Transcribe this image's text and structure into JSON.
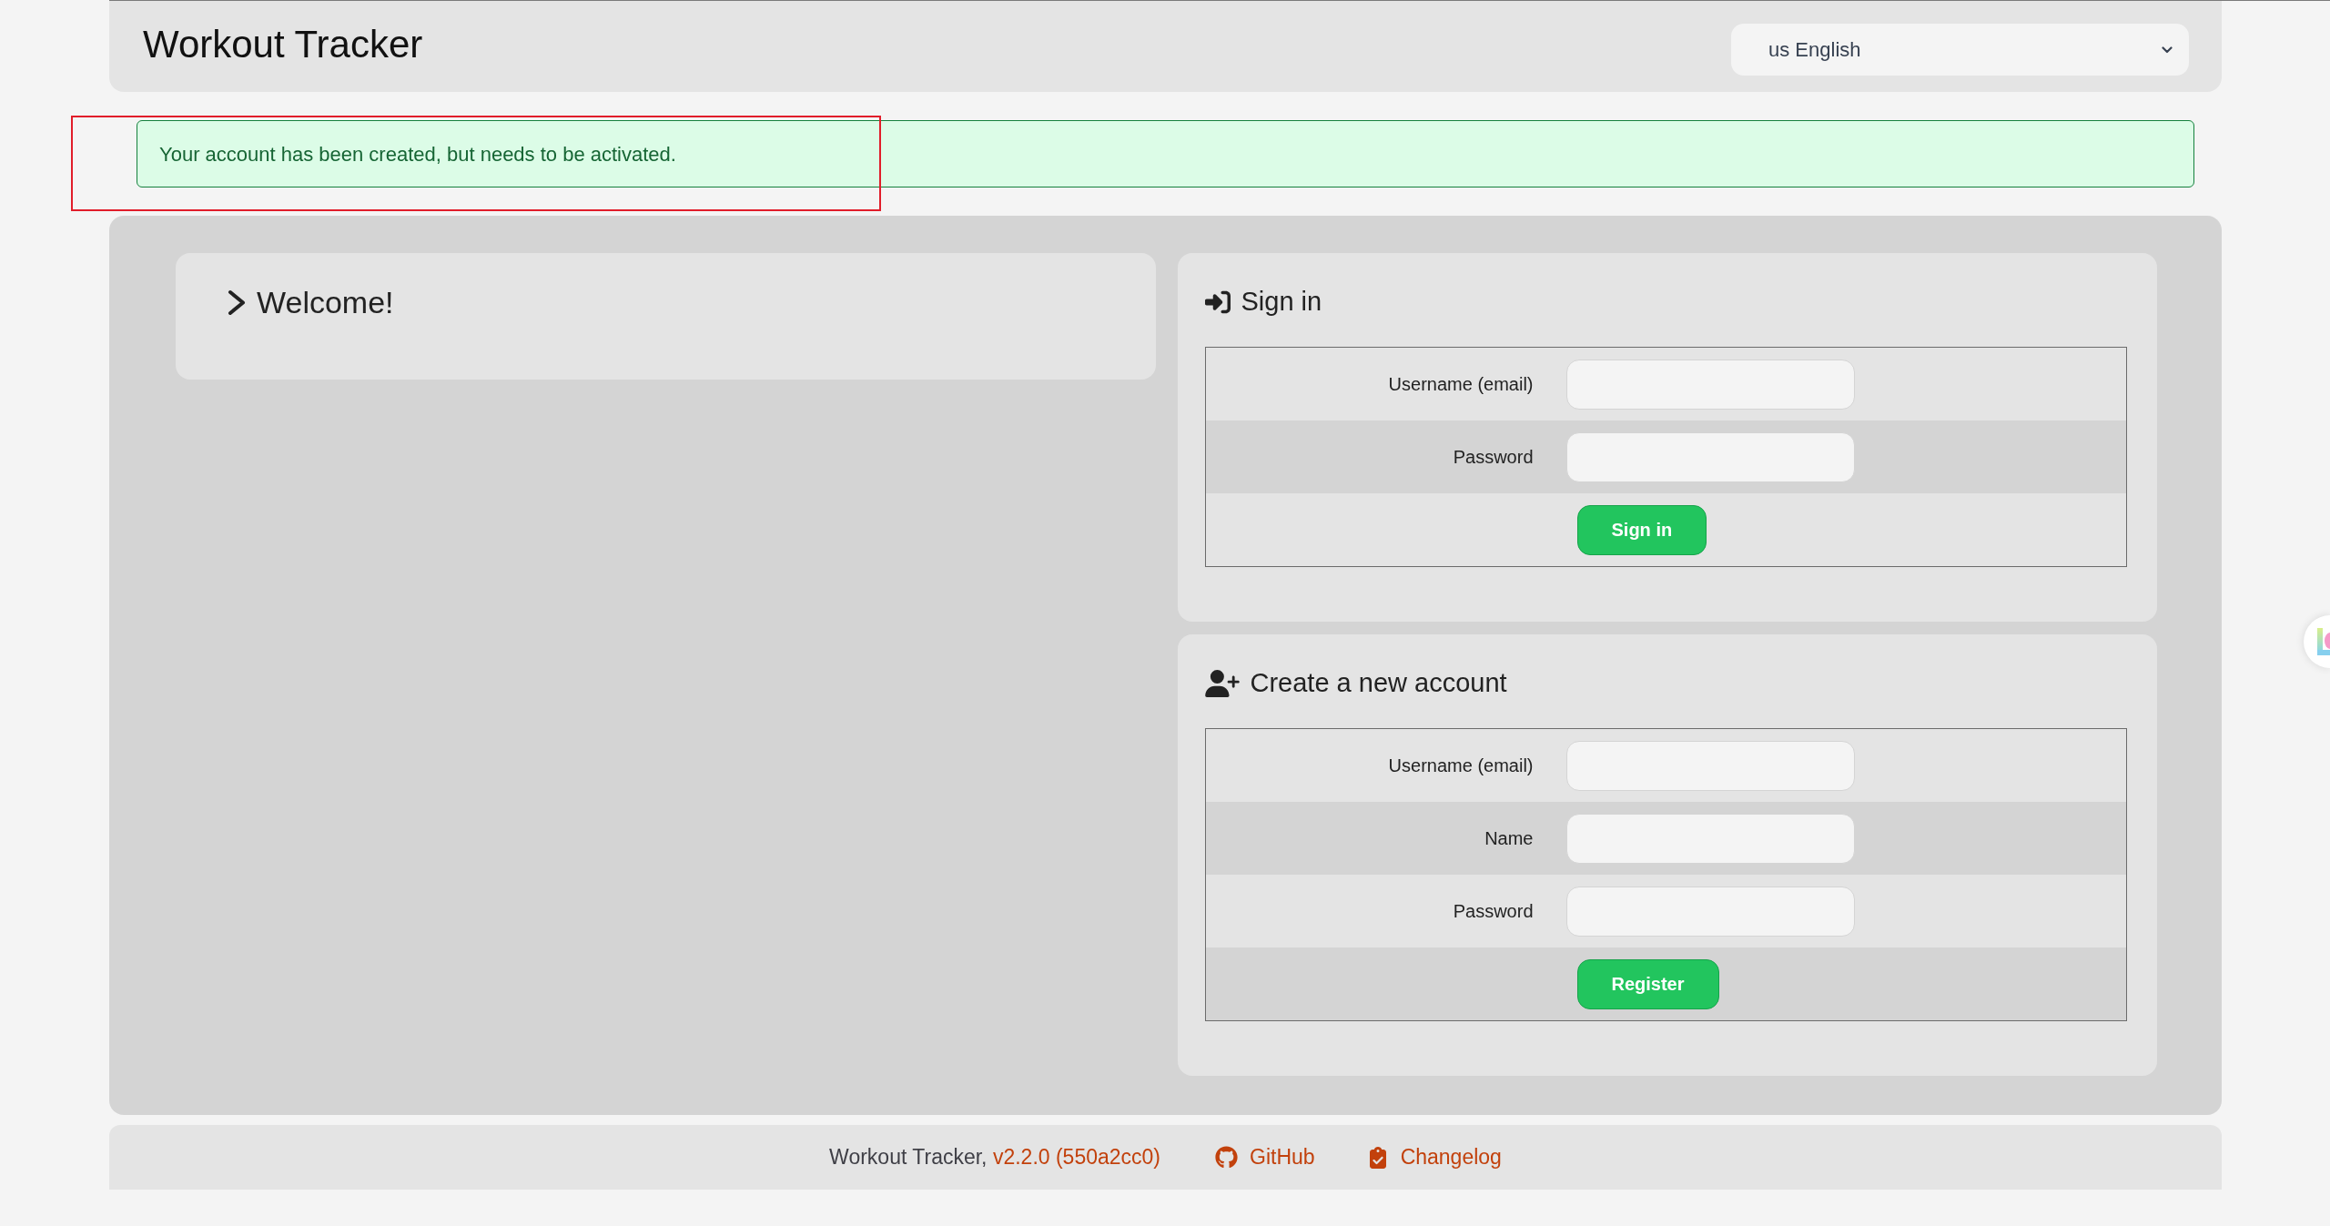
{
  "header": {
    "title": "Workout Tracker",
    "language_select": {
      "value": "us English"
    }
  },
  "alert": {
    "kind": "success",
    "message": "Your account has been created, but needs to be activated."
  },
  "welcome": {
    "title": "Welcome!",
    "expanded": false
  },
  "sign_in": {
    "title": "Sign in",
    "fields": [
      {
        "label": "Username (email)"
      },
      {
        "label": "Password"
      }
    ],
    "button": "Sign in"
  },
  "register": {
    "title": "Create a new account",
    "fields": [
      {
        "label": "Username (email)"
      },
      {
        "label": "Name"
      },
      {
        "label": "Password"
      }
    ],
    "button": "Register"
  },
  "footer": {
    "app_name": "Workout Tracker,",
    "version": "v2.2.0 (550a2cc0)",
    "links": [
      {
        "kind": "github",
        "label": "GitHub"
      },
      {
        "kind": "changelog",
        "label": "Changelog"
      }
    ]
  }
}
